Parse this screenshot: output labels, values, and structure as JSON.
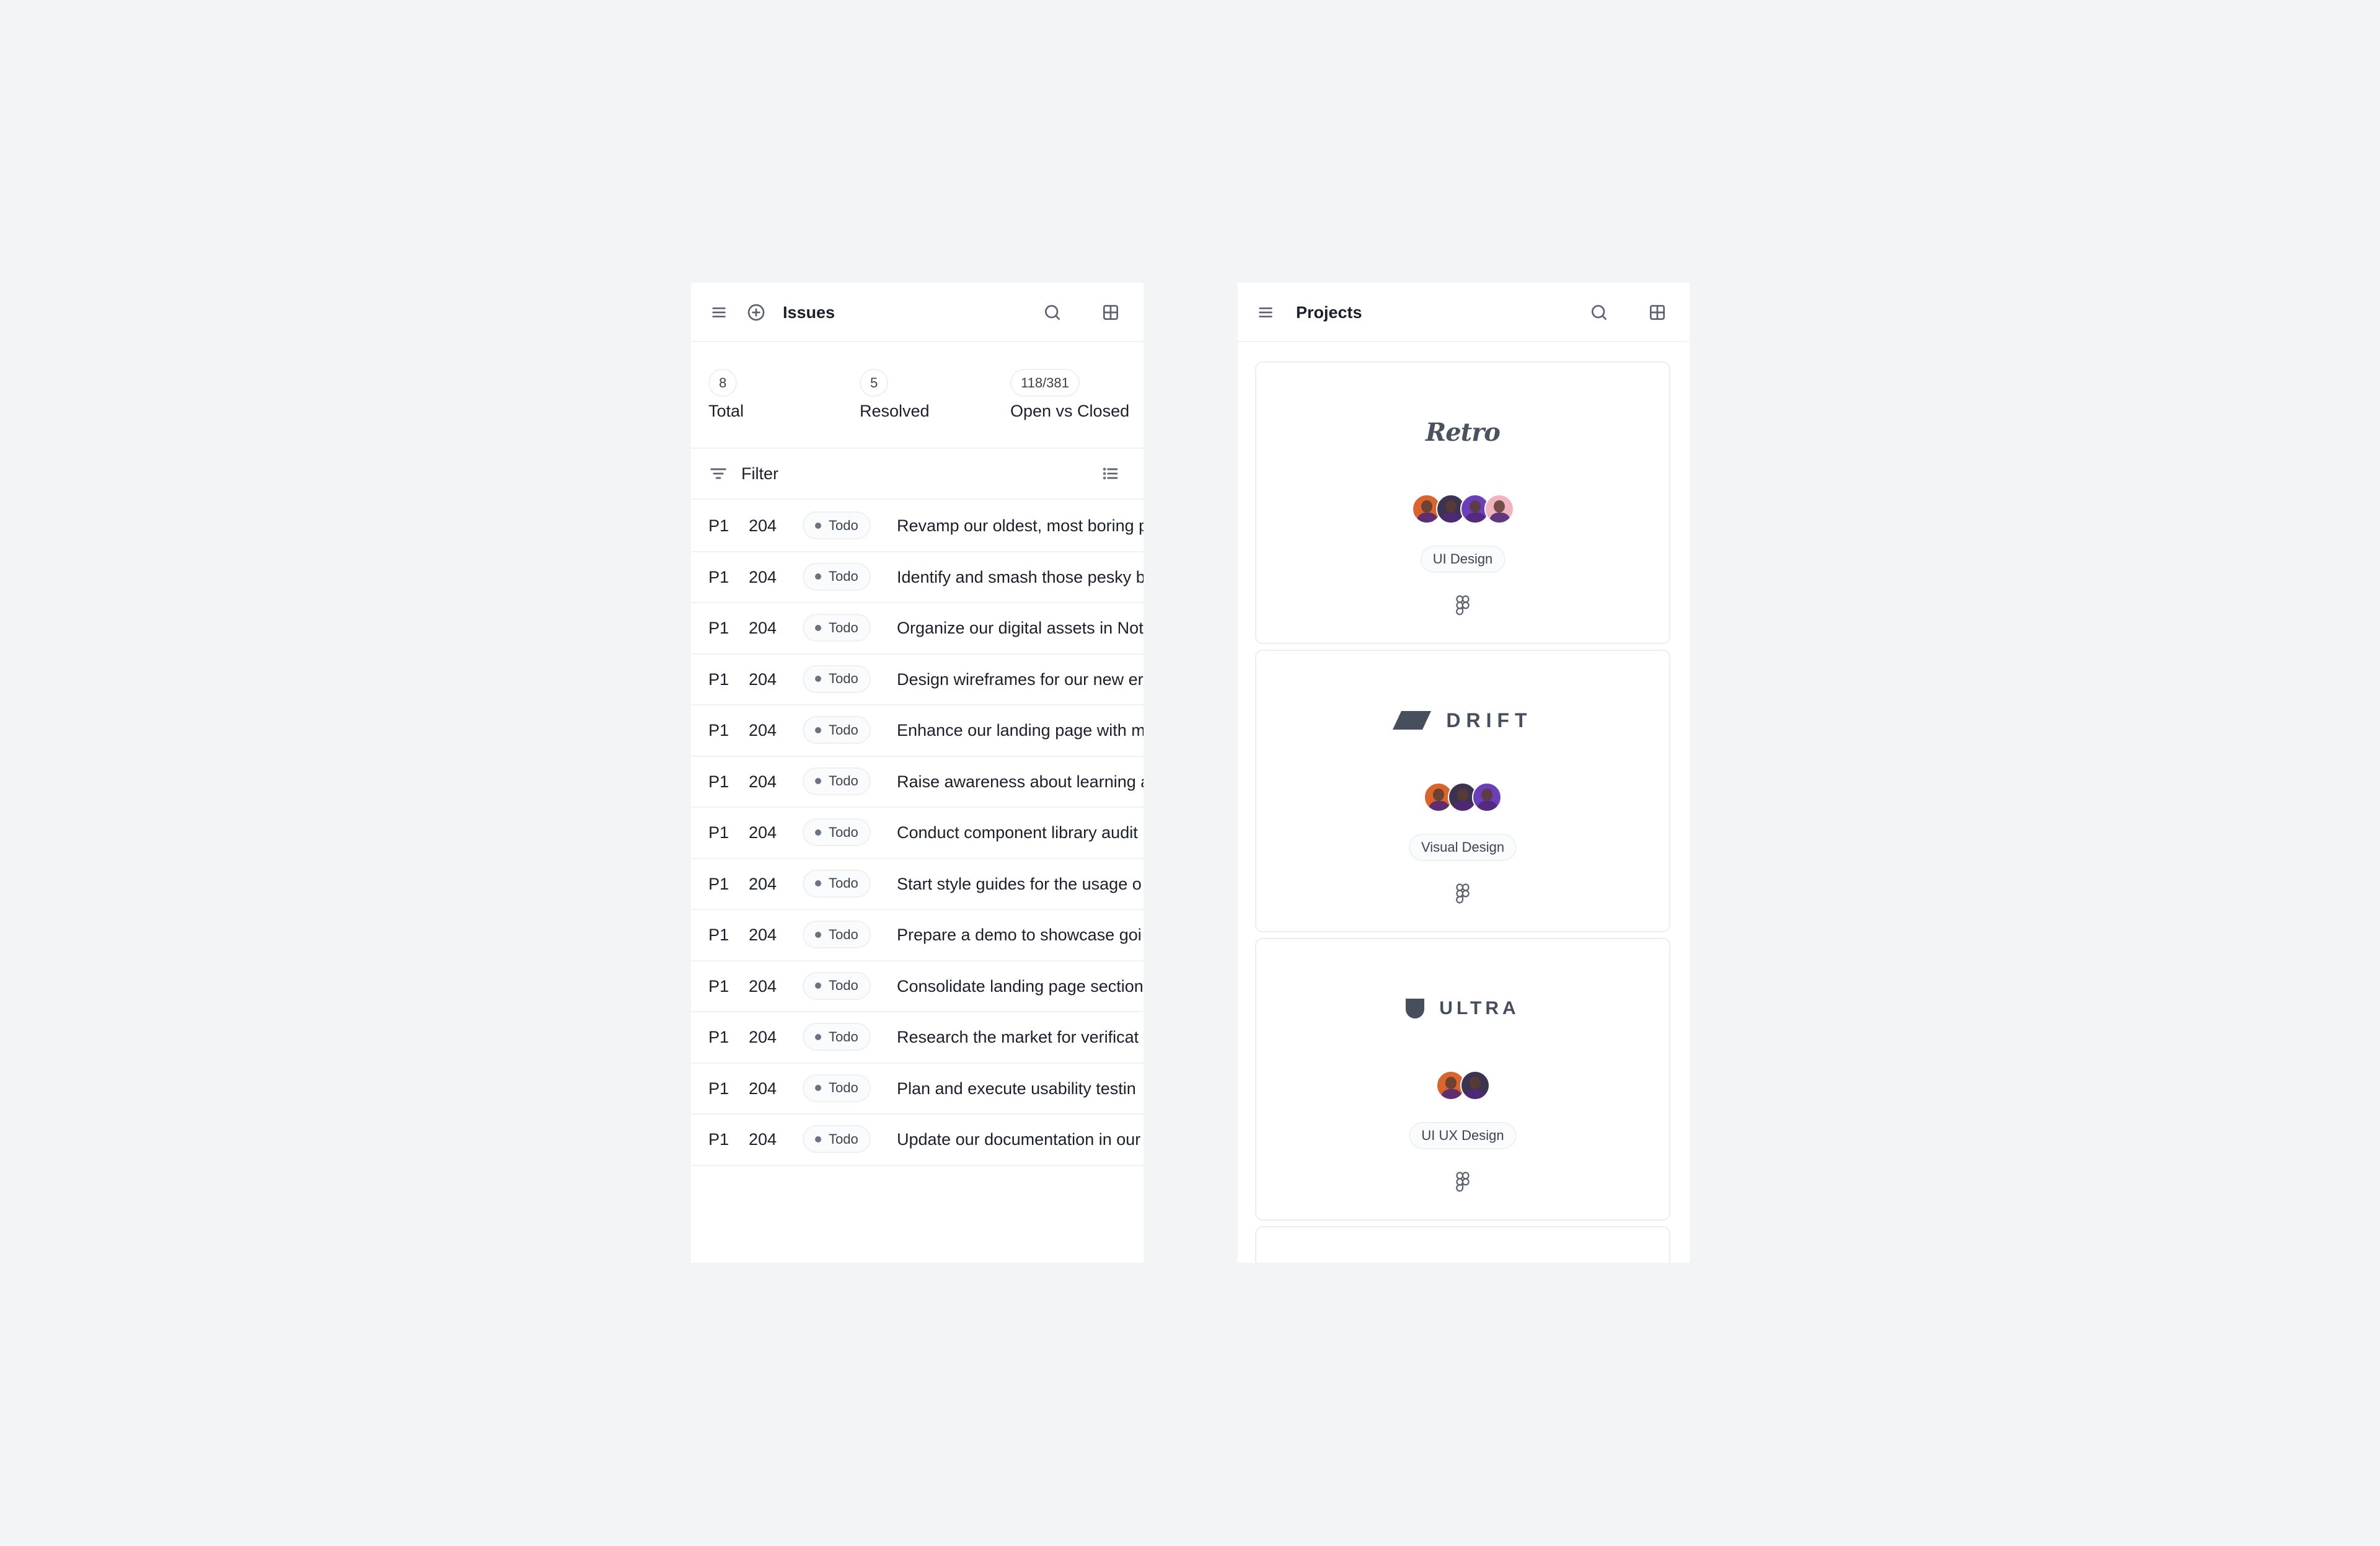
{
  "issues": {
    "title": "Issues",
    "icons": {
      "menu": "hamburger-icon",
      "add": "plus-circle-icon",
      "search": "search-icon",
      "layout": "grid-icon"
    },
    "stats": [
      {
        "value": "8",
        "label": "Total"
      },
      {
        "value": "5",
        "label": "Resolved"
      },
      {
        "value": "118/381",
        "label": "Open vs Closed"
      }
    ],
    "filter_label": "Filter",
    "rows": [
      {
        "priority": "P1",
        "number": "204",
        "status": "Todo",
        "title": "Revamp our oldest, most boring p"
      },
      {
        "priority": "P1",
        "number": "204",
        "status": "Todo",
        "title": "Identify and smash those pesky b"
      },
      {
        "priority": "P1",
        "number": "204",
        "status": "Todo",
        "title": "Organize our digital assets in Not"
      },
      {
        "priority": "P1",
        "number": "204",
        "status": "Todo",
        "title": "Design wireframes for our new er"
      },
      {
        "priority": "P1",
        "number": "204",
        "status": "Todo",
        "title": "Enhance our landing page with m"
      },
      {
        "priority": "P1",
        "number": "204",
        "status": "Todo",
        "title": "Raise awareness about learning a"
      },
      {
        "priority": "P1",
        "number": "204",
        "status": "Todo",
        "title": "Conduct component library audit"
      },
      {
        "priority": "P1",
        "number": "204",
        "status": "Todo",
        "title": "Start style guides for the usage o"
      },
      {
        "priority": "P1",
        "number": "204",
        "status": "Todo",
        "title": "Prepare a demo to showcase goi"
      },
      {
        "priority": "P1",
        "number": "204",
        "status": "Todo",
        "title": "Consolidate landing page section"
      },
      {
        "priority": "P1",
        "number": "204",
        "status": "Todo",
        "title": "Research the market for verificat"
      },
      {
        "priority": "P1",
        "number": "204",
        "status": "Todo",
        "title": "Plan and execute usability testin"
      },
      {
        "priority": "P1",
        "number": "204",
        "status": "Todo",
        "title": "Update our documentation in our"
      }
    ]
  },
  "projects": {
    "title": "Projects",
    "cards": [
      {
        "logo": "Retro",
        "logo_style": "script",
        "members": 4,
        "tag": "UI Design",
        "tool_icon": "figma-icon"
      },
      {
        "logo": "DRIFT",
        "logo_style": "parallelogram-mark",
        "members": 3,
        "tag": "Visual Design",
        "tool_icon": "figma-icon"
      },
      {
        "logo": "ULTRA",
        "logo_style": "shield-mark",
        "members": 2,
        "tag": "UI UX Design",
        "tool_icon": "figma-icon"
      }
    ],
    "avatar_colors": [
      "#d9642e",
      "#3b3350",
      "#6a3fb8",
      "#f2b3c0"
    ]
  },
  "colors": {
    "page_bg": "#f3f4f6",
    "panel_bg": "#ffffff",
    "text": "#1a1f2b",
    "muted_icon": "#5b6270",
    "status_dot": "#6b7280",
    "border": "#f1f2f4"
  }
}
